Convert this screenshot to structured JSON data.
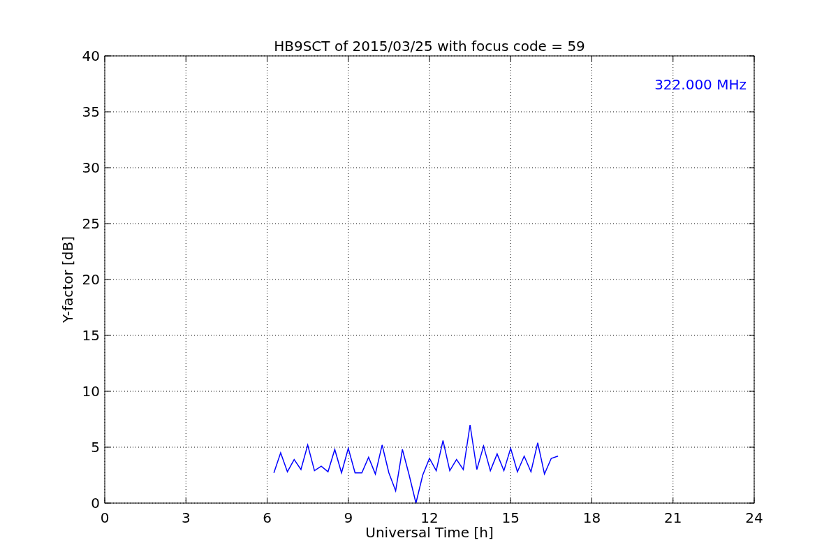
{
  "chart_data": {
    "type": "line",
    "title": "HB9SCT of 2015/03/25 with focus code = 59",
    "xlabel": "Universal Time [h]",
    "ylabel": "Y-factor [dB]",
    "x": [
      6.25,
      6.5,
      6.75,
      7,
      7.25,
      7.5,
      7.75,
      8,
      8.25,
      8.5,
      8.75,
      9,
      9.25,
      9.5,
      9.75,
      10,
      10.25,
      10.5,
      10.75,
      11,
      11.25,
      11.5,
      11.75,
      12,
      12.25,
      12.5,
      12.75,
      13,
      13.25,
      13.5,
      13.75,
      14,
      14.25,
      14.5,
      14.75,
      15,
      15.25,
      15.5,
      15.75,
      16,
      16.25,
      16.5,
      16.75
    ],
    "series": [
      {
        "name": "322.000 MHz",
        "color": "#0000ff",
        "values": [
          2.7,
          4.5,
          2.8,
          3.9,
          3.0,
          5.2,
          2.9,
          3.3,
          2.8,
          4.8,
          2.7,
          4.9,
          2.7,
          2.7,
          4.1,
          2.6,
          5.2,
          2.7,
          1.1,
          4.8,
          2.5,
          0.0,
          2.5,
          4.0,
          2.9,
          5.6,
          2.9,
          3.9,
          3.0,
          7.0,
          3.0,
          5.1,
          2.9,
          4.4,
          2.9,
          4.9,
          2.8,
          4.2,
          2.8,
          5.4,
          2.6,
          4.0,
          4.2
        ]
      }
    ],
    "xlim": [
      0,
      24
    ],
    "ylim": [
      0,
      40
    ],
    "xticks": [
      0,
      3,
      6,
      9,
      12,
      15,
      18,
      21,
      24
    ],
    "yticks": [
      0,
      5,
      10,
      15,
      20,
      25,
      30,
      35,
      40
    ],
    "grid": true
  }
}
